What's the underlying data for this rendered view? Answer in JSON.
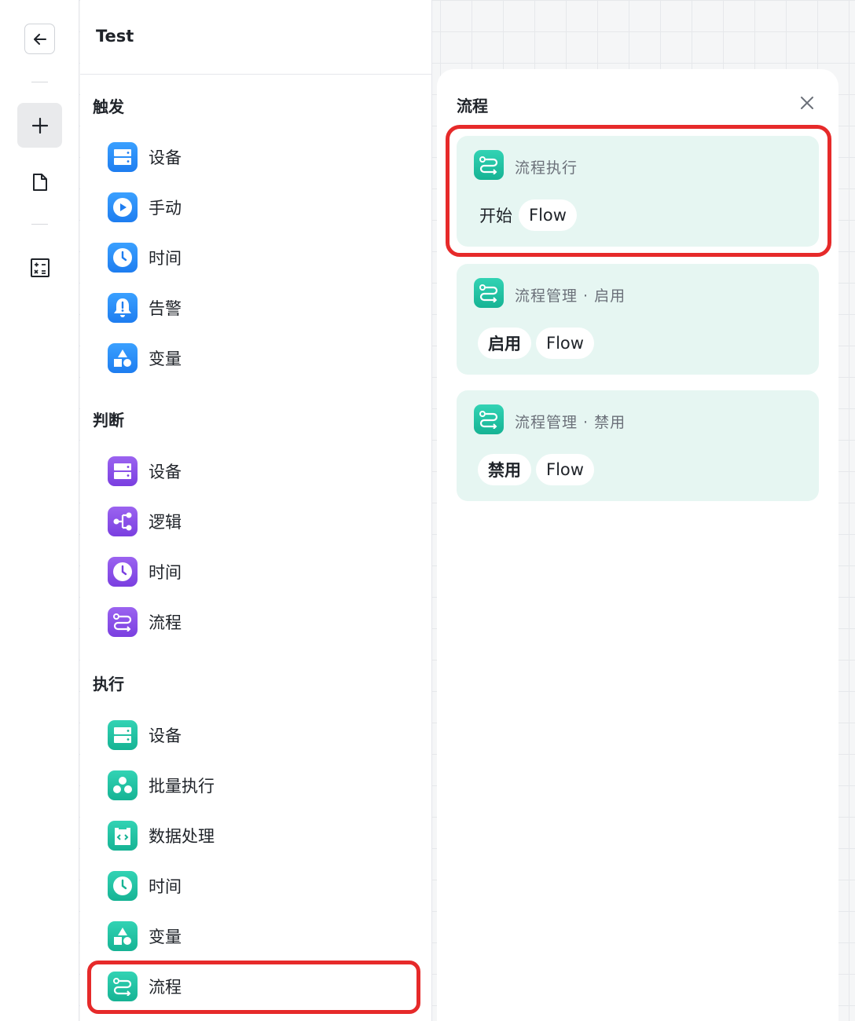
{
  "rail": {
    "back_icon": "arrow-left-icon",
    "add_icon": "plus-icon",
    "doc_icon": "document-icon",
    "calc_icon": "calculator-icon"
  },
  "palette": {
    "title": "Test",
    "sections": [
      {
        "title": "触发",
        "items": [
          {
            "label": "设备",
            "icon": "device-icon"
          },
          {
            "label": "手动",
            "icon": "play-icon"
          },
          {
            "label": "时间",
            "icon": "clock-icon"
          },
          {
            "label": "告警",
            "icon": "bell-icon"
          },
          {
            "label": "变量",
            "icon": "shapes-icon"
          }
        ]
      },
      {
        "title": "判断",
        "items": [
          {
            "label": "设备",
            "icon": "device-icon"
          },
          {
            "label": "逻辑",
            "icon": "branch-icon"
          },
          {
            "label": "时间",
            "icon": "clock-icon"
          },
          {
            "label": "流程",
            "icon": "flow-icon"
          }
        ]
      },
      {
        "title": "执行",
        "items": [
          {
            "label": "设备",
            "icon": "device-icon"
          },
          {
            "label": "批量执行",
            "icon": "batch-icon"
          },
          {
            "label": "数据处理",
            "icon": "code-icon"
          },
          {
            "label": "时间",
            "icon": "clock-icon"
          },
          {
            "label": "变量",
            "icon": "shapes-icon"
          },
          {
            "label": "流程",
            "icon": "flow-icon"
          }
        ]
      }
    ]
  },
  "flow_panel": {
    "title": "流程",
    "close_icon": "close-icon",
    "cards": [
      {
        "title": "流程执行",
        "prefix": "开始",
        "chips": [
          "Flow"
        ]
      },
      {
        "title": "流程管理 · 启用",
        "chips": [
          "启用",
          "Flow"
        ]
      },
      {
        "title": "流程管理 · 禁用",
        "chips": [
          "禁用",
          "Flow"
        ]
      }
    ]
  },
  "colors": {
    "trigger": "#1e7df0",
    "condition": "#7a3fe0",
    "action": "#16b394",
    "card_bg": "#e6f6f2",
    "highlight": "#e62a2a"
  }
}
